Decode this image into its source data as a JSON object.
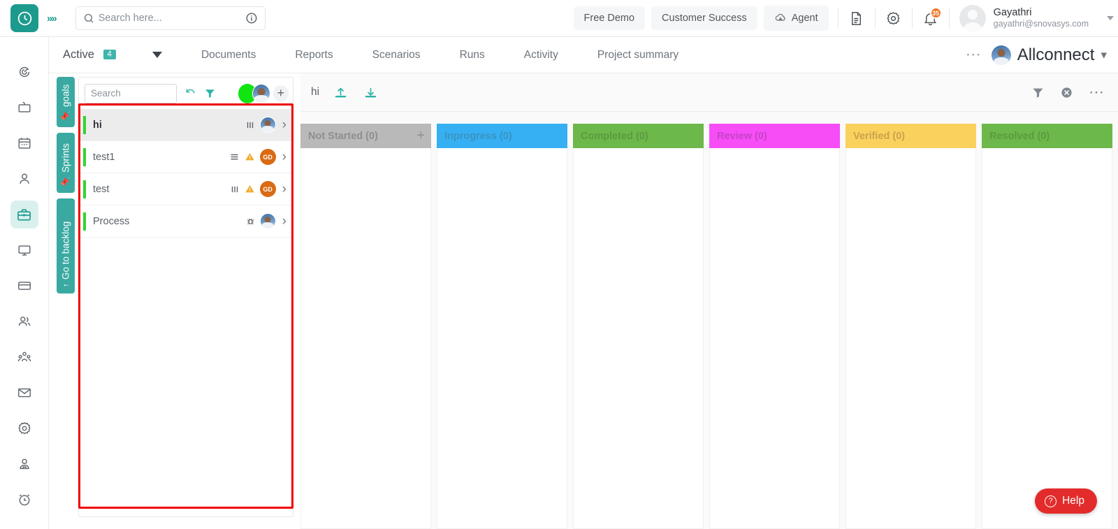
{
  "header": {
    "logo_icon": "clock-logo-icon",
    "expand_icon": "double-chevron-right-icon",
    "search_placeholder": "Search here...",
    "search_value": "",
    "search_icon": "search-icon",
    "info_icon": "info-icon",
    "buttons": [
      {
        "label": "Free Demo",
        "name": "free-demo-button"
      },
      {
        "label": "Customer Success",
        "name": "customer-success-button"
      },
      {
        "label": "Agent",
        "name": "agent-button",
        "icon": "cloud-download-icon"
      }
    ],
    "doc_icon": "document-icon",
    "settings_icon": "gear-icon",
    "bell_icon": "bell-icon",
    "notification_count": "35",
    "user": {
      "name": "Gayathri",
      "email": "gayathri@snovasys.com"
    },
    "user_caret_icon": "caret-down-icon"
  },
  "sidebar": {
    "items": [
      {
        "name": "sidebar-item-dashboard",
        "icon": "spiral-target-icon",
        "active": false
      },
      {
        "name": "sidebar-item-tv",
        "icon": "tv-icon",
        "active": false
      },
      {
        "name": "sidebar-item-calendar",
        "icon": "calendar-icon",
        "active": false
      },
      {
        "name": "sidebar-item-profile",
        "icon": "user-icon",
        "active": false
      },
      {
        "name": "sidebar-item-projects",
        "icon": "briefcase-icon",
        "active": true
      },
      {
        "name": "sidebar-item-monitor",
        "icon": "monitor-icon",
        "active": false
      },
      {
        "name": "sidebar-item-billing",
        "icon": "credit-card-icon",
        "active": false
      },
      {
        "name": "sidebar-item-contacts",
        "icon": "users-icon",
        "active": false
      },
      {
        "name": "sidebar-item-teams",
        "icon": "team-group-icon",
        "active": false
      },
      {
        "name": "sidebar-item-mail",
        "icon": "envelope-icon",
        "active": false
      },
      {
        "name": "sidebar-item-settings",
        "icon": "gear-icon",
        "active": false
      },
      {
        "name": "sidebar-item-account",
        "icon": "person-badge-icon",
        "active": false
      },
      {
        "name": "sidebar-item-timer",
        "icon": "alarm-clock-icon",
        "active": false
      }
    ]
  },
  "tabbar": {
    "active_label": "Active",
    "active_count": "4",
    "dropdown_icon": "caret-down-icon",
    "tabs": [
      {
        "label": "Documents",
        "name": "tab-documents"
      },
      {
        "label": "Reports",
        "name": "tab-reports"
      },
      {
        "label": "Scenarios",
        "name": "tab-scenarios"
      },
      {
        "label": "Runs",
        "name": "tab-runs"
      },
      {
        "label": "Activity",
        "name": "tab-activity"
      },
      {
        "label": "Project summary",
        "name": "tab-project-summary"
      }
    ],
    "more_icon": "ellipsis-icon",
    "project_name": "Allconnect",
    "project_caret_icon": "caret-down-icon"
  },
  "vertical_tabs": [
    {
      "label": "goals",
      "icon": "pin-icon",
      "name": "vtab-goals"
    },
    {
      "label": "Sprints",
      "icon": "pin-icon",
      "name": "vtab-sprints"
    },
    {
      "label": "Go to backlog",
      "icon": "arrow-up-icon",
      "name": "vtab-go-to-backlog"
    }
  ],
  "list_panel": {
    "search_placeholder": "Search",
    "search_value": "",
    "refresh_icon": "refresh-icon",
    "filter_icon": "filter-icon",
    "status_dot_color": "#11e511",
    "avatar_icon": "user-avatar",
    "add_icon": "plus-icon",
    "items": [
      {
        "label": "hi",
        "name": "list-item-hi",
        "selected": true,
        "bar_color": "#2fd62f",
        "icons": [
          "bars-icon"
        ],
        "avatar_type": "photo",
        "avatar_initials": "",
        "chevron_icon": "chevron-right-icon"
      },
      {
        "label": "test1",
        "name": "list-item-test1",
        "selected": false,
        "bar_color": "#2fd62f",
        "icons": [
          "menu-lines-icon",
          "warning-icon"
        ],
        "avatar_type": "initials",
        "avatar_initials": "GD",
        "chevron_icon": "chevron-right-icon"
      },
      {
        "label": "test",
        "name": "list-item-test",
        "selected": false,
        "bar_color": "#2fd62f",
        "icons": [
          "bars-icon",
          "warning-icon"
        ],
        "avatar_type": "initials",
        "avatar_initials": "GD",
        "chevron_icon": "chevron-right-icon"
      },
      {
        "label": "Process",
        "name": "list-item-process",
        "selected": false,
        "bar_color": "#2fd62f",
        "icons": [
          "bug-icon"
        ],
        "avatar_type": "photo",
        "avatar_initials": "",
        "chevron_icon": "chevron-right-icon"
      }
    ]
  },
  "board": {
    "title": "hi",
    "upload_icon": "upload-icon",
    "download_icon": "download-icon",
    "filter_icon": "filter-icon",
    "clear_icon": "clear-circle-icon",
    "more_icon": "ellipsis-icon",
    "columns": [
      {
        "label": "Not Started (0)",
        "name": "column-not-started",
        "color": "#b9b9b9",
        "text": "#8f8f8f",
        "has_add": true,
        "add_icon": "plus-icon"
      },
      {
        "label": "Inprogress (0)",
        "name": "column-inprogress",
        "color": "#36b0f2",
        "text": "#3a93c4",
        "has_add": false
      },
      {
        "label": "Completed (0)",
        "name": "column-completed",
        "color": "#6cb84a",
        "text": "#5c9a41",
        "has_add": false
      },
      {
        "label": "Review (0)",
        "name": "column-review",
        "color": "#f champ",
        "text": "",
        "has_add": false
      },
      {
        "label": "Verified (0)",
        "name": "column-verified",
        "color": "#fbd15e",
        "text": "#c9a34c",
        "has_add": false
      },
      {
        "label": "Resolved (0)",
        "name": "column-resolved",
        "color": "#6cb84a",
        "text": "#5c9a41",
        "has_add": false
      }
    ],
    "column_colors": [
      "#b9b9b9",
      "#36b0f2",
      "#6cb84a",
      "#f74df7",
      "#fbd15e",
      "#6cb84a"
    ],
    "column_text_colors": [
      "#8f8f8f",
      "#3a93c4",
      "#5c9a41",
      "#c443c4",
      "#c9a34c",
      "#5c9a41"
    ]
  },
  "help": {
    "label": "Help",
    "icon": "question-circle-icon",
    "color": "#e32b2b"
  }
}
